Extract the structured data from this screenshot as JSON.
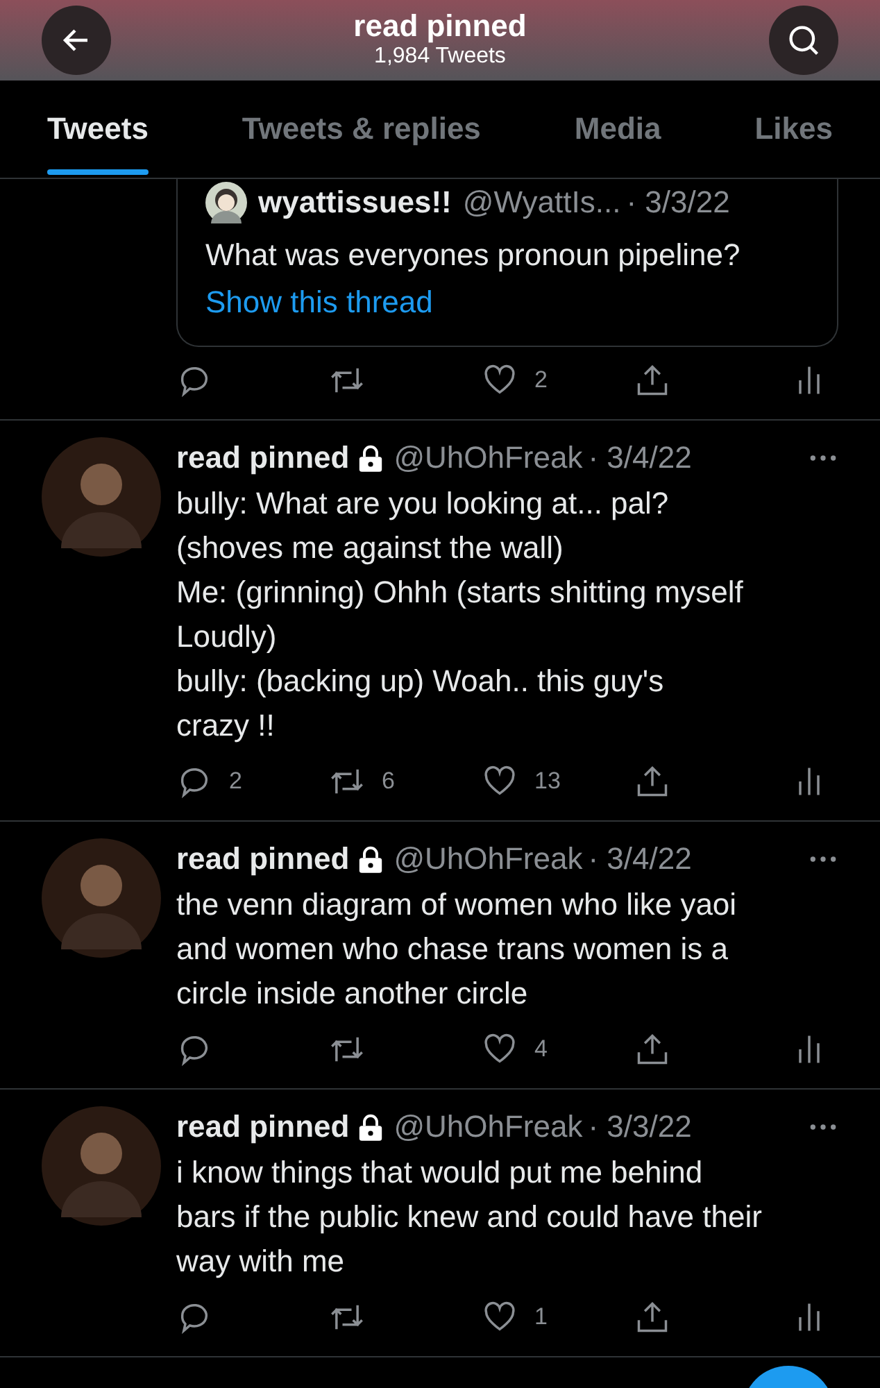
{
  "header": {
    "title": "read pinned",
    "subtitle": "1,984 Tweets"
  },
  "tabs": [
    {
      "label": "Tweets",
      "selected": true
    },
    {
      "label": "Tweets & replies",
      "selected": false
    },
    {
      "label": "Media",
      "selected": false
    },
    {
      "label": "Likes",
      "selected": false
    }
  ],
  "quoted": {
    "name": "wyattissues!!",
    "handle": "@WyattIs...",
    "date": "· 3/3/22",
    "text": "What was everyones pronoun pipeline?",
    "link": "Show this thread",
    "actions": [
      {
        "kind": "reply"
      },
      {
        "kind": "retweet"
      },
      {
        "kind": "like",
        "count": "2"
      },
      {
        "kind": "share"
      },
      {
        "kind": "stats"
      }
    ]
  },
  "tweets": [
    {
      "name": "read pinned",
      "locked": true,
      "handle": "@UhOhFreak",
      "date": "· 3/4/22",
      "text": "bully: What are you looking at... pal?\n(shoves me against the wall)\nMe: (grinning) Ohhh (starts shitting myself\nLoudly)\nbully: (backing up) Woah.. this guy's\ncrazy !!",
      "actions": [
        {
          "kind": "reply",
          "count": "2"
        },
        {
          "kind": "retweet",
          "count": "6"
        },
        {
          "kind": "like",
          "count": "13"
        },
        {
          "kind": "share"
        },
        {
          "kind": "stats"
        }
      ]
    },
    {
      "name": "read pinned",
      "locked": true,
      "handle": "@UhOhFreak",
      "date": "· 3/4/22",
      "text": "the venn diagram of women who like yaoi\nand women who chase trans women is a\ncircle inside another circle",
      "actions": [
        {
          "kind": "reply"
        },
        {
          "kind": "retweet"
        },
        {
          "kind": "like",
          "count": "4"
        },
        {
          "kind": "share"
        },
        {
          "kind": "stats"
        }
      ]
    },
    {
      "name": "read pinned",
      "locked": true,
      "handle": "@UhOhFreak",
      "date": "· 3/3/22",
      "text": "i know things that would put me behind\nbars if the public knew and could have their\nway with me",
      "actions": [
        {
          "kind": "reply"
        },
        {
          "kind": "retweet"
        },
        {
          "kind": "like",
          "count": "1"
        },
        {
          "kind": "share"
        },
        {
          "kind": "stats"
        }
      ]
    }
  ]
}
